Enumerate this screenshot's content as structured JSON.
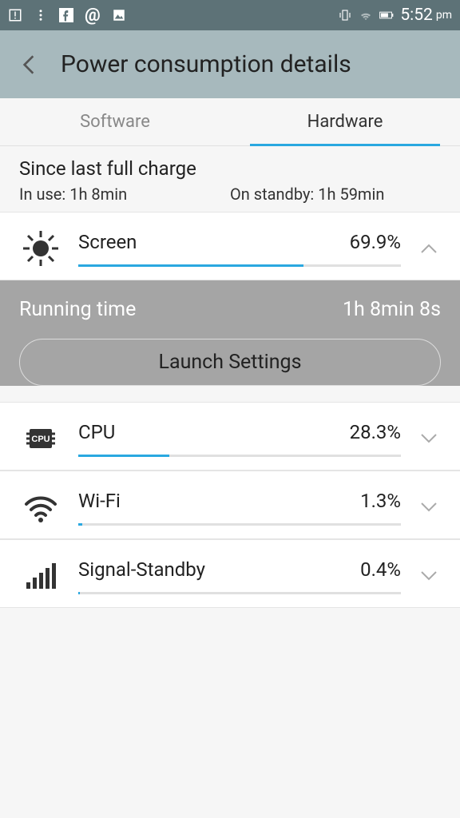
{
  "status": {
    "time": "5:52",
    "ampm": "pm"
  },
  "header": {
    "title": "Power consumption details"
  },
  "tabs": {
    "software": "Software",
    "hardware": "Hardware"
  },
  "since": {
    "title": "Since last full charge",
    "in_use_label": "In use: ",
    "in_use_val": "1h 8min",
    "standby_label": "On standby: ",
    "standby_val": "1h 59min"
  },
  "items": {
    "screen": {
      "name": "Screen",
      "pct": "69.9%",
      "bar": 69.9
    },
    "cpu": {
      "name": "CPU",
      "pct": "28.3%",
      "bar": 28.3,
      "icon_text": "CPU"
    },
    "wifi": {
      "name": "Wi-Fi",
      "pct": "1.3%",
      "bar": 1.3
    },
    "signal": {
      "name": "Signal-Standby",
      "pct": "0.4%",
      "bar": 0.4
    }
  },
  "expanded": {
    "running_label": "Running time",
    "running_val": "1h 8min 8s",
    "launch": "Launch Settings"
  }
}
